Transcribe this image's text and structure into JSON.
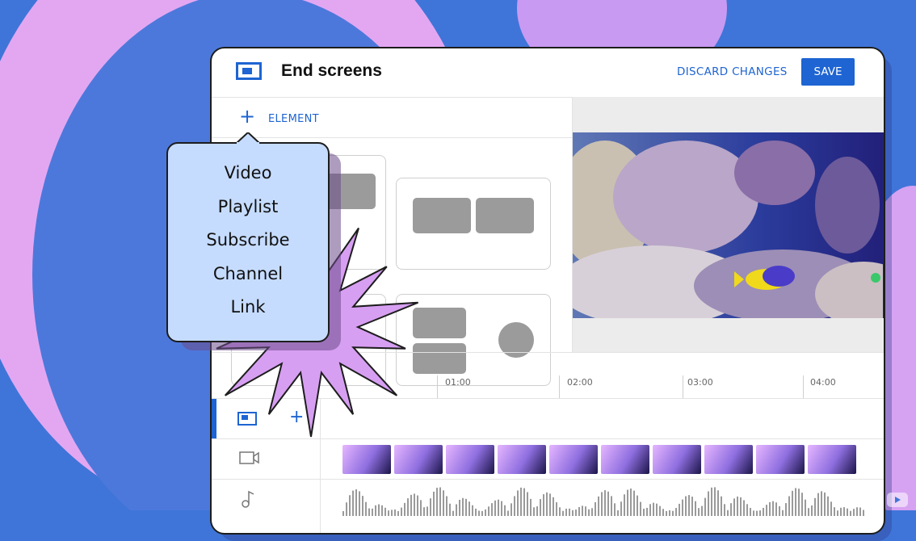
{
  "header": {
    "title": "End screens",
    "discard_label": "DISCARD CHANGES",
    "save_label": "SAVE"
  },
  "element_bar": {
    "add_label": "ELEMENT"
  },
  "element_menu": {
    "items": [
      "Video",
      "Playlist",
      "Subscribe",
      "Channel",
      "Link"
    ]
  },
  "timeline": {
    "ticks": [
      "01:00",
      "02:00",
      "03:00",
      "04:00"
    ]
  },
  "colors": {
    "accent": "#1e64d2",
    "menu_bg": "#c6dcff",
    "burst": "#d79ff2",
    "background": "#3f75d8"
  },
  "icons": [
    "screen-icon",
    "plus-icon",
    "video-camera-icon",
    "music-note-icon",
    "youtube-logo-icon"
  ]
}
